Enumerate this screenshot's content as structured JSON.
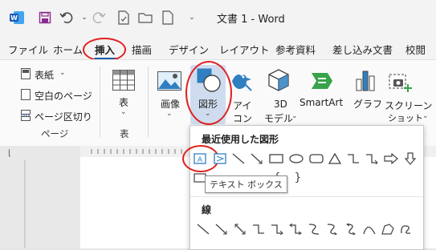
{
  "title_bar": {
    "document_title": "文書 1 - Word"
  },
  "tabs": [
    "ファイル",
    "ホーム",
    "挿入",
    "描画",
    "デザイン",
    "レイアウト",
    "参考資料",
    "差し込み文書",
    "校閲"
  ],
  "ribbon": {
    "pages_group": {
      "items": [
        "表紙",
        "空白のページ",
        "ページ区切り"
      ],
      "group_label": "ページ"
    },
    "table_group": {
      "button": "表",
      "group_label": "表"
    },
    "illustrations": {
      "image": "画像",
      "shapes": "図形",
      "icons_line1": "アイ",
      "icons_line2": "コン",
      "model3d_line1": "3D",
      "model3d_line2": "モデル",
      "smartart": "SmartArt",
      "chart": "グラフ",
      "screenshot_line1": "スクリーン",
      "screenshot_line2": "ショット"
    }
  },
  "shapes_panel": {
    "recent_heading": "最近使用した図形",
    "lines_heading": "線",
    "tooltip": "テキスト ボックス"
  },
  "colors": {
    "accent": "#1a5dab",
    "highlight": "#e0201e"
  }
}
